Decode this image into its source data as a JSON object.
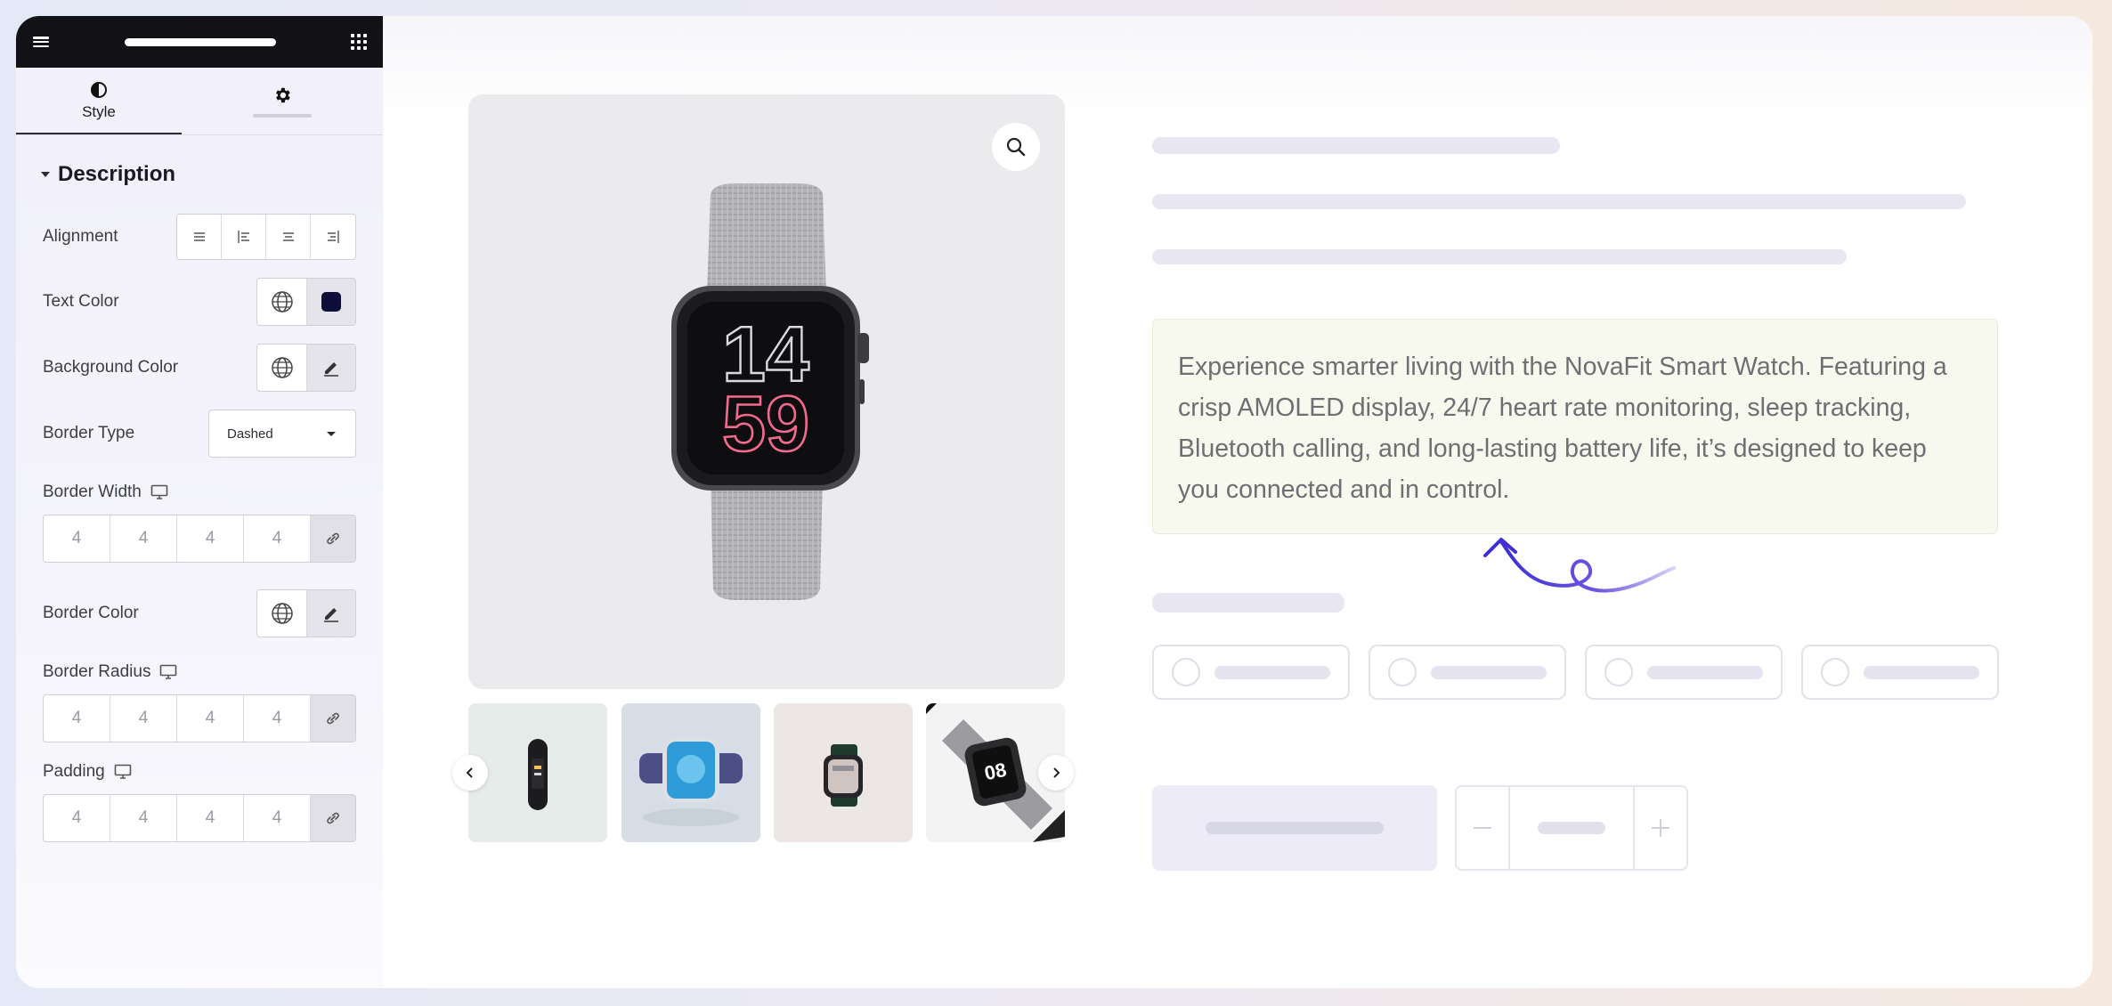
{
  "sidebar": {
    "tabs": [
      {
        "label": "Style",
        "icon": "contrast-icon"
      },
      {
        "label": "",
        "icon": "gear-icon"
      }
    ],
    "section_title": "Description",
    "controls": {
      "alignment_label": "Alignment",
      "text_color_label": "Text Color",
      "text_color_value": "#0d0d3a",
      "background_color_label": "Background Color",
      "border_type_label": "Border Type",
      "border_type_value": "Dashed",
      "border_width_label": "Border Width",
      "border_width_values": [
        "4",
        "4",
        "4",
        "4"
      ],
      "border_color_label": "Border Color",
      "border_radius_label": "Border Radius",
      "border_radius_values": [
        "4",
        "4",
        "4",
        "4"
      ],
      "padding_label": "Padding",
      "padding_values": [
        "4",
        "4",
        "4",
        "4"
      ]
    }
  },
  "product": {
    "description": "Experience smarter living with the NovaFit Smart Watch. Featuring a crisp AMOLED display, 24/7 heart rate monitoring, sleep tracking, Bluetooth calling, and long-lasting battery life, it’s designed to keep you connected and in control.",
    "watch_face": {
      "hour": "14",
      "minute": "59"
    },
    "colors": {
      "accent_arrow": "#4a3bd8",
      "description_bg": "#f8f9ee"
    }
  }
}
